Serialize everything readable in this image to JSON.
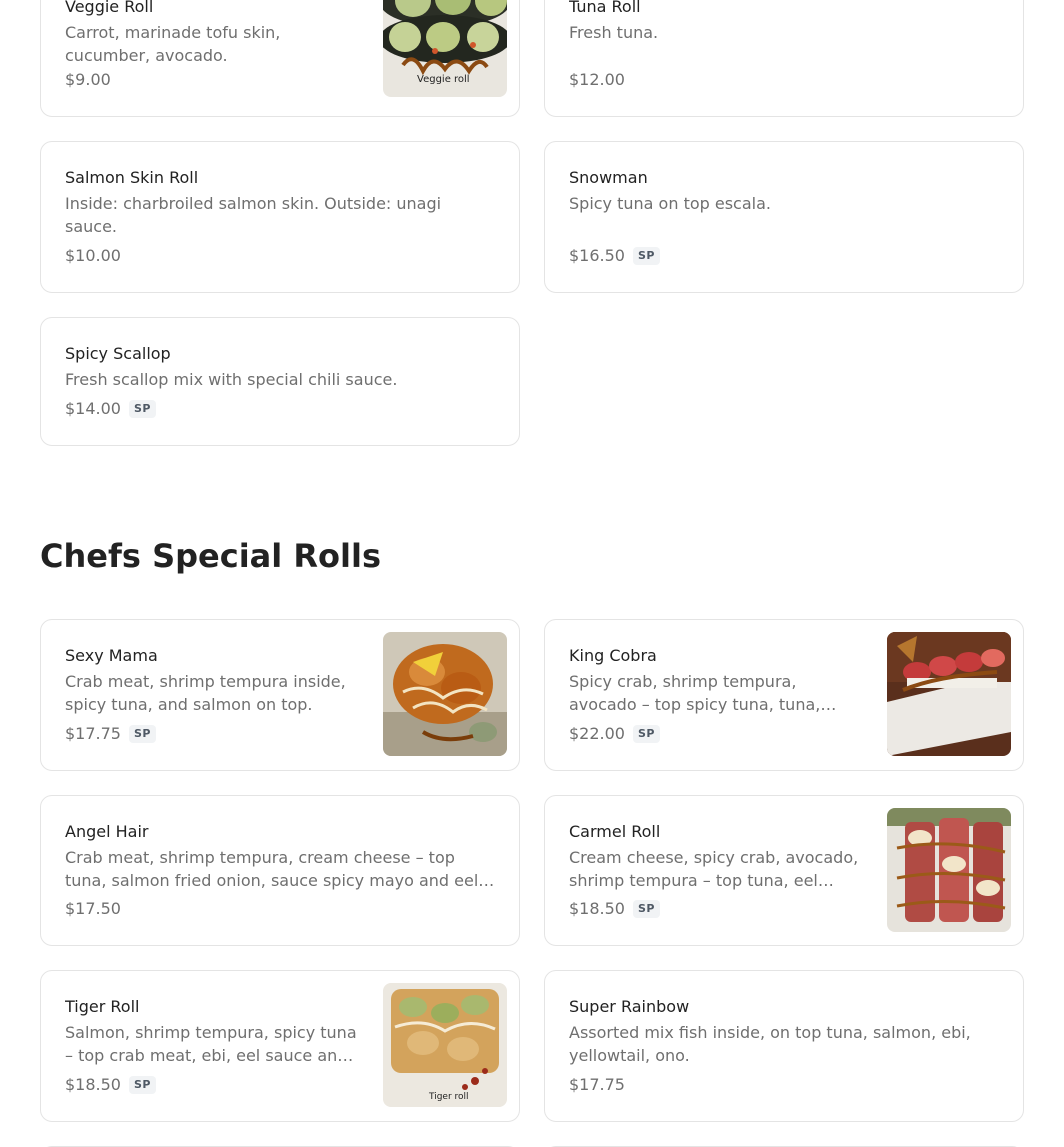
{
  "section_prev": {
    "items": [
      {
        "name": "Veggie Roll",
        "desc": "Carrot, marinade tofu skin, cucumber, avocado.",
        "price": "$9.00",
        "image_caption": "Veggie roll"
      },
      {
        "name": "Tuna Roll",
        "desc": "Fresh tuna.",
        "price": "$12.00"
      },
      {
        "name": "Salmon Skin Roll",
        "desc": "Inside: charbroiled salmon skin. Outside: unagi sauce.",
        "price": "$10.00"
      },
      {
        "name": "Snowman",
        "desc": "Spicy tuna on top escala.",
        "price": "$16.50",
        "badge": "SP"
      },
      {
        "name": "Spicy Scallop",
        "desc": "Fresh scallop mix with special chili sauce.",
        "price": "$14.00",
        "badge": "SP"
      }
    ]
  },
  "chefs_special": {
    "title": "Chefs Special Rolls",
    "items": [
      {
        "name": "Sexy Mama",
        "desc": "Crab meat, shrimp tempura inside, spicy tuna, and salmon on top.",
        "price": "$17.75",
        "badge": "SP"
      },
      {
        "name": "King Cobra",
        "desc": "Spicy crab, shrimp tempura, avocado – top spicy tuna, tuna, salmon, eel sauce and spicy mayo.",
        "price": "$22.00",
        "badge": "SP"
      },
      {
        "name": "Angel Hair",
        "desc": "Crab meat, shrimp tempura, cream cheese – top tuna, salmon fried onion, sauce spicy mayo and eel sauce.",
        "price": "$17.50"
      },
      {
        "name": "Carmel Roll",
        "desc": "Cream cheese, spicy crab, avocado, shrimp tempura – top tuna, eel sauce and spicy mayo.",
        "price": "$18.50",
        "badge": "SP"
      },
      {
        "name": "Tiger Roll",
        "desc": "Salmon, shrimp tempura, spicy tuna – top crab meat, ebi, eel sauce and spicy mayo.",
        "price": "$18.50",
        "badge": "SP",
        "image_caption": "Tiger roll"
      },
      {
        "name": "Super Rainbow",
        "desc": "Assorted mix fish inside, on top tuna, salmon, ebi, yellowtail, ono.",
        "price": "$17.75"
      }
    ]
  },
  "colors": {
    "card_border": "#e4e4e4",
    "text_primary": "#222222",
    "text_secondary": "#6f6f6f",
    "badge_bg": "#f1f3f5",
    "badge_text": "#4f5965"
  }
}
